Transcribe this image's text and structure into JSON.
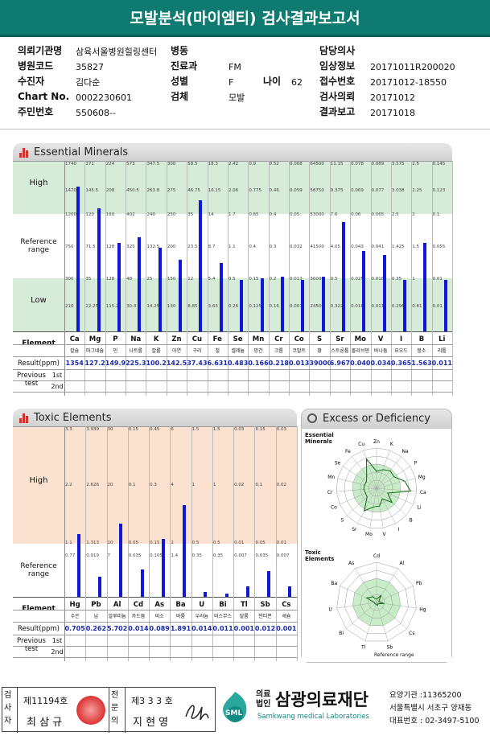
{
  "title": "모발분석(마이엠티) 검사결과보고서",
  "patient": {
    "rows": [
      [
        {
          "label": "의뢰기관명",
          "value": "삼육서울병원힐링센터"
        },
        {
          "label": "병동",
          "value": ""
        },
        {
          "label": "담당의사",
          "value": ""
        }
      ],
      [
        {
          "label": "병원코드",
          "value": "35827"
        },
        {
          "label": "진료과",
          "value": "FM"
        },
        {
          "label": "임상정보",
          "value": "20171011R200020"
        }
      ],
      [
        {
          "label": "수진자",
          "value": "김다순"
        },
        {
          "label": "성별",
          "value": "F"
        },
        {
          "label": "접수번호",
          "value": "20171012-18550"
        }
      ],
      [
        {
          "label": "Chart No.",
          "value": "0002230601"
        },
        {
          "label": "검체",
          "value": "모발"
        },
        {
          "label": "검사의뢰",
          "value": "20171012"
        }
      ],
      [
        {
          "label": "주민번호",
          "value": "550608--"
        },
        {
          "label": "",
          "value": ""
        },
        {
          "label": "결과보고",
          "value": "20171018"
        }
      ]
    ],
    "age_label": "나이",
    "age_value": "62"
  },
  "essential": {
    "header": "Essential Minerals",
    "row_labels": {
      "high": "High",
      "reference": "Reference\nrange",
      "low": "Low"
    },
    "element_label": "Element",
    "result_label": "Result(ppm)",
    "previous_label": "Previous\ntest",
    "first": "1st",
    "second": "2nd",
    "elements": [
      {
        "sym": "Ca",
        "kor": "칼슘",
        "result": "1354",
        "ticks": [
          "1740",
          "1470",
          "1200",
          "750",
          "300",
          "210"
        ],
        "level": 0.85
      },
      {
        "sym": "Mg",
        "kor": "마그네슘",
        "result": "127.2",
        "ticks": [
          "171",
          "145.5",
          "120",
          "71.5",
          "35",
          "22.25"
        ],
        "level": 0.72
      },
      {
        "sym": "P",
        "kor": "인",
        "result": "149.9",
        "ticks": [
          "224",
          "208",
          "160",
          "128",
          "128",
          "115.2"
        ],
        "level": 0.52
      },
      {
        "sym": "Na",
        "kor": "나트륨",
        "result": "225.3",
        "ticks": [
          "573",
          "450.5",
          "402",
          "325",
          "48",
          "30.3"
        ],
        "level": 0.55
      },
      {
        "sym": "K",
        "kor": "칼륨",
        "result": "100.2",
        "ticks": [
          "347.5",
          "263.8",
          "240",
          "132.5",
          "25",
          "14.25"
        ],
        "level": 0.49
      },
      {
        "sym": "Zn",
        "kor": "아연",
        "result": "142.5",
        "ticks": [
          "300",
          "275",
          "250",
          "200",
          "150",
          "130"
        ],
        "level": 0.42
      },
      {
        "sym": "Cu",
        "kor": "구리",
        "result": "37.43",
        "ticks": [
          "58.5",
          "46.75",
          "35",
          "23.5",
          "12",
          "8.85"
        ],
        "level": 0.77
      },
      {
        "sym": "Fe",
        "kor": "철",
        "result": "6.631",
        "ticks": [
          "18.3",
          "16.15",
          "14",
          "8.7",
          "5.4",
          "3.63"
        ],
        "level": 0.4
      },
      {
        "sym": "Se",
        "kor": "셀레늄",
        "result": "0.483",
        "ticks": [
          "2.42",
          "2.06",
          "1.7",
          "1.1",
          "0.5",
          "0.26"
        ],
        "level": 0.3
      },
      {
        "sym": "Mn",
        "kor": "망간",
        "result": "0.166",
        "ticks": [
          "0.9",
          "0.775",
          "0.65",
          "0.4",
          "0.15",
          "0.125"
        ],
        "level": 0.31
      },
      {
        "sym": "Cr",
        "kor": "크롬",
        "result": "0.218",
        "ticks": [
          "0.52",
          "0.46",
          "0.4",
          "0.3",
          "0.2",
          "0.16"
        ],
        "level": 0.32
      },
      {
        "sym": "Co",
        "kor": "코발트",
        "result": "0.013",
        "ticks": [
          "0.068",
          "0.059",
          "0.05",
          "0.032",
          "0.013",
          "0.007"
        ],
        "level": 0.3
      },
      {
        "sym": "S",
        "kor": "황",
        "result": "39000",
        "ticks": [
          "64500",
          "58750",
          "53000",
          "41500",
          "30000",
          "24500"
        ],
        "level": 0.32
      },
      {
        "sym": "Sr",
        "kor": "스트론튬",
        "result": "6.967",
        "ticks": [
          "11.15",
          "9.375",
          "7.6",
          "4.05",
          "0.5",
          "0.322"
        ],
        "level": 0.64
      },
      {
        "sym": "Mo",
        "kor": "몰리브덴",
        "result": "0.040",
        "ticks": [
          "0.078",
          "0.069",
          "0.06",
          "0.043",
          "0.025",
          "0.018"
        ],
        "level": 0.47
      },
      {
        "sym": "V",
        "kor": "바나듐",
        "result": "0.034",
        "ticks": [
          "0.089",
          "0.077",
          "0.065",
          "0.041",
          "0.018",
          "0.011"
        ],
        "level": 0.45
      },
      {
        "sym": "I",
        "kor": "요오드",
        "result": "0.365",
        "ticks": [
          "3.575",
          "3.038",
          "2.5",
          "1.425",
          "0.35",
          "0.296"
        ],
        "level": 0.3
      },
      {
        "sym": "B",
        "kor": "붕소",
        "result": "1.563",
        "ticks": [
          "2.5",
          "2.25",
          "2",
          "1.5",
          "1",
          "0.81"
        ],
        "level": 0.52
      },
      {
        "sym": "Li",
        "kor": "리튬",
        "result": "0.011",
        "ticks": [
          "0.145",
          "0.123",
          "0.1",
          "0.055",
          "0.01",
          "0.01"
        ],
        "level": 0.3
      }
    ]
  },
  "toxic": {
    "header": "Toxic Elements",
    "row_labels": {
      "high": "High",
      "reference": "Reference\nrange"
    },
    "element_label": "Element",
    "result_label": "Result(ppm)",
    "previous_label": "Previous\ntest",
    "first": "1st",
    "second": "2nd",
    "elements": [
      {
        "sym": "Hg",
        "kor": "수은",
        "result": "0.705",
        "ticks": [
          "3.3",
          "2.2",
          "1.1",
          "0.77"
        ],
        "level": 0.37
      },
      {
        "sym": "Pb",
        "kor": "납",
        "result": "0.262",
        "ticks": [
          "3.939",
          "2.626",
          "1.313",
          "0.919"
        ],
        "level": 0.12
      },
      {
        "sym": "Al",
        "kor": "알루미늄",
        "result": "5.702",
        "ticks": [
          "30",
          "20",
          "10",
          "7"
        ],
        "level": 0.43
      },
      {
        "sym": "Cd",
        "kor": "카드뮴",
        "result": "0.014",
        "ticks": [
          "0.15",
          "0.1",
          "0.05",
          "0.035"
        ],
        "level": 0.16
      },
      {
        "sym": "As",
        "kor": "비소",
        "result": "0.089",
        "ticks": [
          "0.45",
          "0.3",
          "0.15",
          "0.105"
        ],
        "level": 0.34
      },
      {
        "sym": "Ba",
        "kor": "바륨",
        "result": "1.891",
        "ticks": [
          "6",
          "4",
          "2",
          "1.4"
        ],
        "level": 0.54
      },
      {
        "sym": "U",
        "kor": "우라늄",
        "result": "0.014",
        "ticks": [
          "1.5",
          "1",
          "0.5",
          "0.35"
        ],
        "level": 0.03
      },
      {
        "sym": "Bi",
        "kor": "비스무스",
        "result": "0.011",
        "ticks": [
          "1.5",
          "1",
          "0.5",
          "0.35"
        ],
        "level": 0.02
      },
      {
        "sym": "Tl",
        "kor": "탈륨",
        "result": "0.001",
        "ticks": [
          "0.03",
          "0.02",
          "0.01",
          "0.007"
        ],
        "level": 0.06
      },
      {
        "sym": "Sb",
        "kor": "안티몬",
        "result": "0.012",
        "ticks": [
          "0.15",
          "0.1",
          "0.05",
          "0.035"
        ],
        "level": 0.15
      },
      {
        "sym": "Cs",
        "kor": "세슘",
        "result": "0.001",
        "ticks": [
          "0.03",
          "0.02",
          "0.01",
          "0.007"
        ],
        "level": 0.06
      }
    ]
  },
  "excess": {
    "header": "Excess or Deficiency",
    "essential_title": "Essential\nMinerals",
    "toxic_title": "Toxic\nElements",
    "reference_label": "Reference range",
    "essential_labels": [
      "Zn",
      "K",
      "Na",
      "P",
      "Mg",
      "Ca",
      "Li",
      "B",
      "I",
      "V",
      "Mo",
      "Sr",
      "S",
      "Co",
      "Cr",
      "Mn",
      "Se",
      "Fe",
      "Cu"
    ],
    "toxic_labels": [
      "Cd",
      "Al",
      "Pb",
      "Hg",
      "Cs",
      "Sb",
      "Tl",
      "Bi",
      "U",
      "Ba",
      "As"
    ]
  },
  "footer": {
    "examiner_label": "검사자",
    "examiner_no": "제11194호",
    "examiner_name": "최 삼 규",
    "specialist_label": "전문의",
    "specialist_no": "제3 3 3 호",
    "specialist_name": "지 현 영",
    "org_prefix": "의료\n법인",
    "org_name": "삼광의료재단",
    "org_en": "Samkwang medical Laboratories",
    "institution": "요양기관 :11365200",
    "address": "서울특별시 서초구 양재동",
    "phone": "대표번호 : 02-3497-5100",
    "logo_text": "SML"
  },
  "colors": {
    "title_bg": "#0f7a6f",
    "high_bg": "#d6ecd8",
    "ref_bg": "#ffffff",
    "bar": "#1018d8",
    "tox_bg": "#fbe1cf",
    "result": "#1a2aa8"
  }
}
